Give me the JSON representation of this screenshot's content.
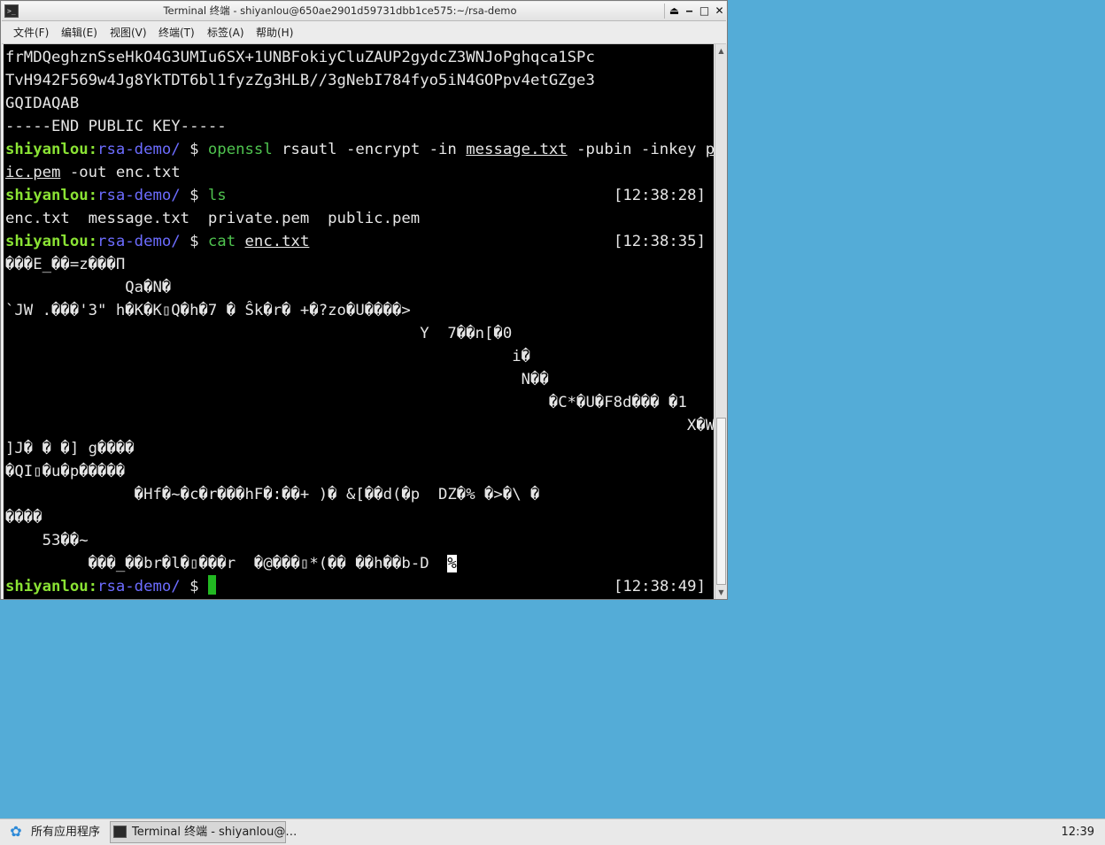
{
  "window": {
    "title": "Terminal 终端 - shiyanlou@650ae2901d59731dbb1ce575:~/rsa-demo",
    "app_icon": "terminal-icon",
    "buttons": {
      "shade": "⏏",
      "minimize": "‒",
      "maximize": "□",
      "close": "✕"
    }
  },
  "menu": [
    "文件(F)",
    "编辑(E)",
    "视图(V)",
    "终端(T)",
    "标签(A)",
    "帮助(H)"
  ],
  "terminal": {
    "prompt_user": "shiyanlou",
    "prompt_colon": ":",
    "prompt_path": "rsa-demo/",
    "prompt_dollar": " $ ",
    "key_lines": [
      "frMDQeghznSseHkO4G3UMIu6SX+1UNBFokiyCluZAUP2gydcZ3WNJoPghqca1SPc",
      "TvH942F569w4Jg8YkTDT6bl1fyzZg3HLB//3gNebI784fyo5iN4GOPpv4etGZge3",
      "GQIDAQAB",
      "-----END PUBLIC KEY-----"
    ],
    "cmd1": {
      "cmd": "openssl",
      "a": " rsautl -encrypt -in ",
      "file1": "message.txt",
      "b": " -pubin -inkey ",
      "file2a": "publ",
      "file2b": "ic.pem",
      "c": " -out enc.txt"
    },
    "cmd2": {
      "cmd": "ls",
      "time": "[12:38:28]"
    },
    "ls_output": "enc.txt  message.txt  private.pem  public.pem",
    "cmd3": {
      "cmd": "cat",
      "space": " ",
      "file": "enc.txt",
      "time": "[12:38:35]"
    },
    "garbage": [
      "���E_��=z���П",
      "             Qa�N�",
      "`JW .���'3\" h�K�K▯Q�h�7 � Ŝk�r� +�?zo�U����>",
      "                                             Y  7��n[�0",
      "                                                       i�",
      "                                                        N��",
      "                                                           �C*�U�F8d��� �1",
      "                                                                          X�WF;D",
      "]J� � �] g����",
      "�QI▯�u�p�����",
      "              �Hf�~�c�r���hF�:��+ )� &[��d(�p  DZ�% �>�\\ �",
      "����",
      "    53��~",
      "         ���_��br�l�▯���r  �@���▯*(�� ��h��b-D  "
    ],
    "garbage_end": "%",
    "final_time": "[12:38:49]"
  },
  "scrollbar": {
    "up": "▲",
    "down": "▼"
  },
  "taskbar": {
    "apps_icon": "apps-menu-icon",
    "apps_label": "所有应用程序",
    "task_icon": "terminal-icon",
    "task_label": "Terminal 终端 - shiyanlou@…",
    "clock": "12:39"
  }
}
